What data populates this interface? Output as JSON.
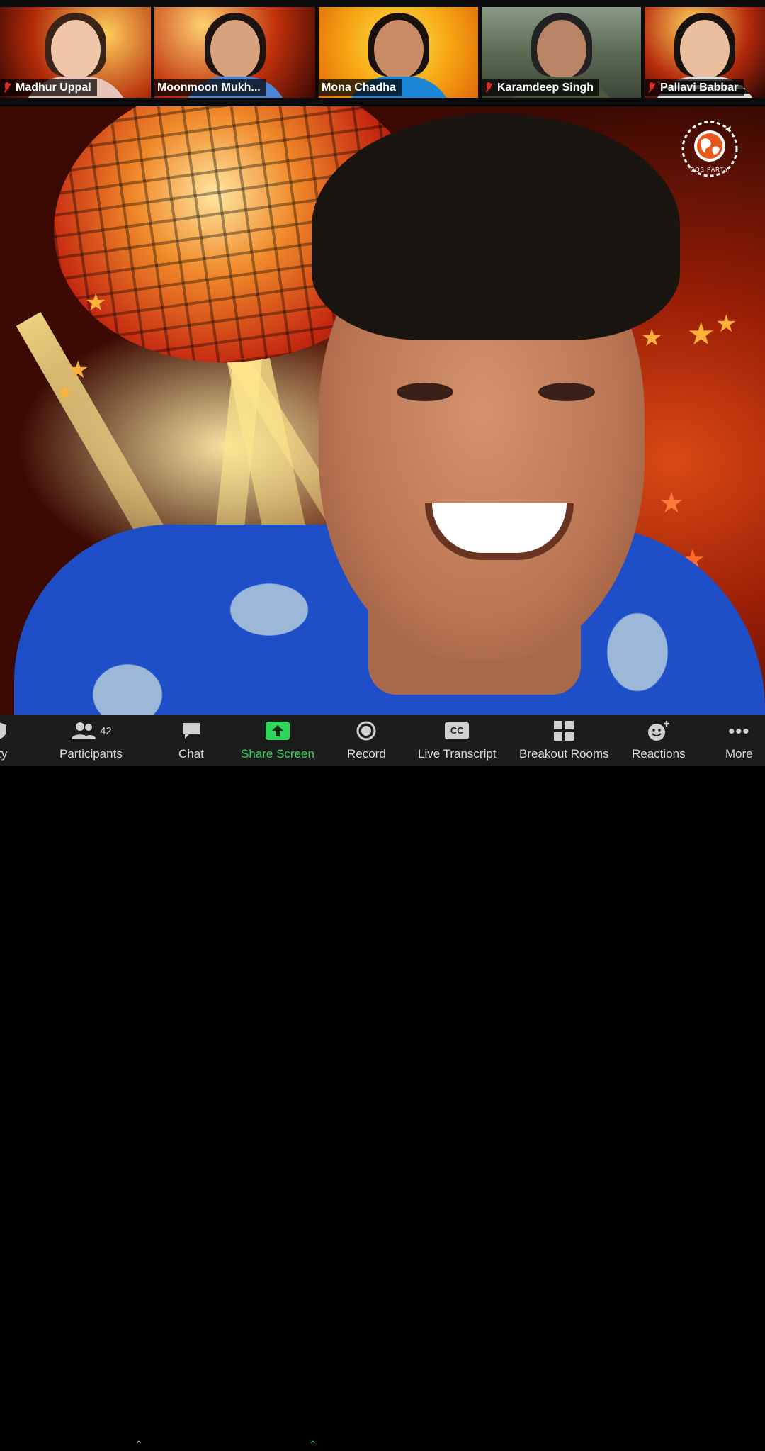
{
  "participants": [
    {
      "name": "Madhur Uppal",
      "muted": true
    },
    {
      "name": "Moonmoon Mukh...",
      "muted": false
    },
    {
      "name": "Mona Chadha",
      "muted": false
    },
    {
      "name": "Karamdeep Singh",
      "muted": true
    },
    {
      "name": "Pallavi Babbar",
      "muted": true
    }
  ],
  "logo": {
    "text": "SOS PARTY"
  },
  "toolbar": {
    "security": "rity",
    "participants": "Participants",
    "participants_count": "42",
    "chat": "Chat",
    "share_screen": "Share Screen",
    "record": "Record",
    "live_transcript": "Live Transcript",
    "cc_badge": "CC",
    "breakout_rooms": "Breakout Rooms",
    "reactions": "Reactions",
    "more": "More"
  },
  "colors": {
    "share_green": "#2dd55b",
    "muted_red": "#e02828",
    "toolbar_bg": "#1c1c1c"
  }
}
